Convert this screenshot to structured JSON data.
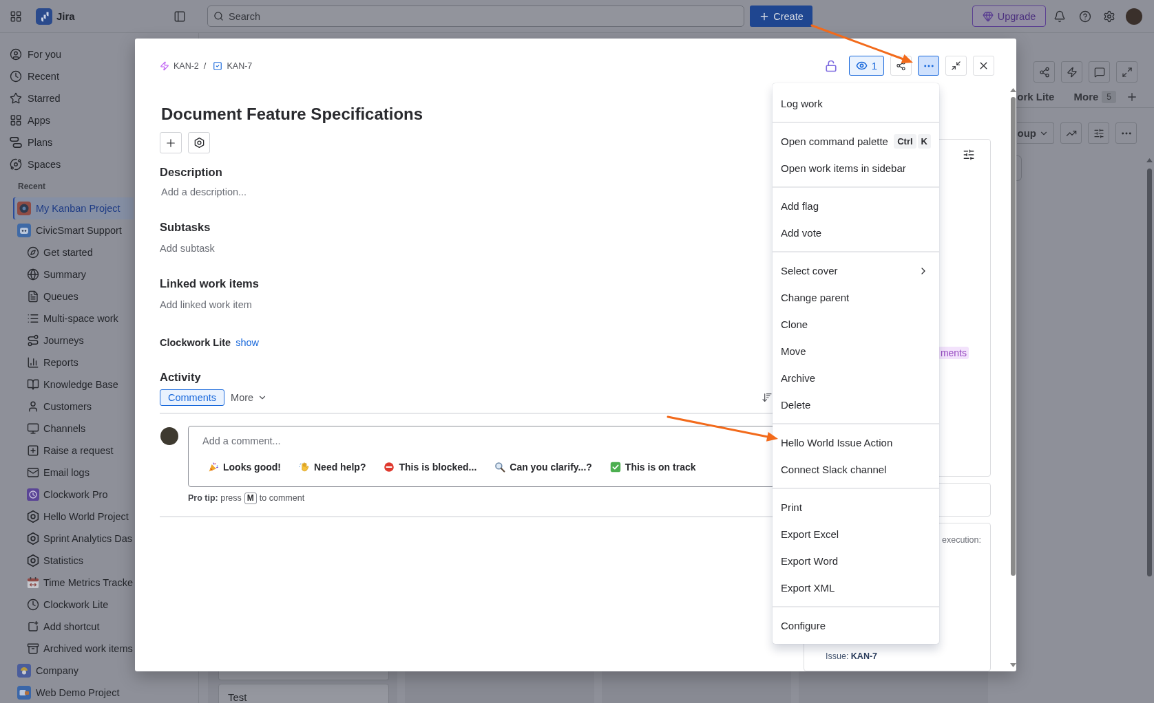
{
  "topbar": {
    "app_name": "Jira",
    "search": {
      "placeholder": "Search"
    },
    "create": "Create",
    "upgrade": "Upgrade"
  },
  "sidebar": {
    "nav": [
      {
        "label": "For you",
        "selected": false
      },
      {
        "label": "Recent",
        "selected": false
      },
      {
        "label": "Starred",
        "selected": false
      },
      {
        "label": "Apps",
        "selected": false
      },
      {
        "label": "Plans",
        "selected": false
      },
      {
        "label": "Spaces",
        "selected": false
      }
    ],
    "recent_heading": "Recent",
    "projects": [
      {
        "name": "My Kanban Project",
        "selected": true
      },
      {
        "name": "CivicSmart Support",
        "selected": false,
        "children": [
          {
            "label": "Get started",
            "selected": false
          },
          {
            "label": "Summary",
            "selected": false
          },
          {
            "label": "Queues",
            "selected": false
          },
          {
            "label": "Multi-space work",
            "selected": false
          },
          {
            "label": "Journeys",
            "selected": false
          },
          {
            "label": "Reports",
            "selected": false
          },
          {
            "label": "Knowledge Base",
            "selected": false
          },
          {
            "label": "Customers",
            "selected": false
          },
          {
            "label": "Channels",
            "selected": false
          },
          {
            "label": "Raise a request",
            "selected": false
          },
          {
            "label": "Email logs",
            "selected": false
          },
          {
            "label": "Clockwork Pro",
            "selected": false
          },
          {
            "label": "Hello World Project",
            "selected": false
          },
          {
            "label": "Sprint Analytics Das",
            "selected": false
          },
          {
            "label": "Statistics",
            "selected": false
          },
          {
            "label": "Time Metrics Tracke",
            "selected": false
          },
          {
            "label": "Clockwork Lite",
            "selected": false
          },
          {
            "label": "Add shortcut",
            "selected": false
          },
          {
            "label": "Archived work items",
            "selected": false
          }
        ]
      },
      {
        "name": "Company",
        "selected": false
      },
      {
        "name": "Web Demo Project",
        "selected": false
      }
    ]
  },
  "board": {
    "tabs": [
      {
        "label": "ork Lite",
        "selected": false
      },
      {
        "label": "More",
        "count": "5",
        "selected": false
      }
    ],
    "group_button": "oup",
    "cards": [
      "Test"
    ]
  },
  "modal": {
    "breadcrumbs": [
      {
        "key": "KAN-2",
        "kind": "epic"
      },
      {
        "key": "KAN-7",
        "kind": "task"
      }
    ],
    "separator": "/",
    "actions": {
      "watching": true,
      "watchers": "1",
      "menu_open": true
    },
    "title": "Document Feature Specifications",
    "sections": [
      {
        "kind": "field",
        "heading": "Description",
        "placeholder": "Add a description..."
      },
      {
        "kind": "action",
        "heading": "Subtasks",
        "action": "Add subtask"
      },
      {
        "kind": "action",
        "heading": "Linked work items",
        "action": "Add linked work item"
      }
    ],
    "app_field": {
      "label": "Clockwork Lite",
      "link": "show"
    },
    "activity": {
      "heading": "Activity",
      "tabs": [
        {
          "label": "Comments",
          "selected": true
        }
      ],
      "more": "More",
      "comment": {
        "placeholder": "Add a comment...",
        "quick_replies": [
          "Looks good!",
          "Need help?",
          "This is blocked...",
          "Can you clarify...?",
          "This is on track"
        ]
      },
      "pro_tip": {
        "lead": "**Pro tip:** press",
        "key": "M",
        "tail": "to comment"
      }
    },
    "details": {
      "tag": "ments",
      "note": "execution:",
      "issue": "Issue: **KAN-7**"
    }
  },
  "menu": {
    "groups": [
      [
        {
          "label": "Log work",
          "kind": "plain"
        }
      ],
      [
        {
          "label": "Open command palette",
          "kind": "shortcut",
          "keys": [
            "Ctrl",
            "K"
          ]
        },
        {
          "label": "Open work items in sidebar",
          "kind": "plain"
        }
      ],
      [
        {
          "label": "Add flag",
          "kind": "plain"
        },
        {
          "label": "Add vote",
          "kind": "plain"
        }
      ],
      [
        {
          "label": "Select cover",
          "kind": "submenu"
        },
        {
          "label": "Change parent",
          "kind": "plain"
        },
        {
          "label": "Clone",
          "kind": "plain"
        },
        {
          "label": "Move",
          "kind": "plain"
        },
        {
          "label": "Archive",
          "kind": "plain"
        },
        {
          "label": "Delete",
          "kind": "plain"
        }
      ],
      [
        {
          "label": "Hello World Issue Action",
          "kind": "plain"
        },
        {
          "label": "Connect Slack channel",
          "kind": "plain"
        }
      ],
      [
        {
          "label": "Print",
          "kind": "plain"
        },
        {
          "label": "Export Excel",
          "kind": "plain"
        },
        {
          "label": "Export Word",
          "kind": "plain"
        },
        {
          "label": "Export XML",
          "kind": "plain"
        }
      ],
      [
        {
          "label": "Configure",
          "kind": "plain"
        }
      ]
    ]
  }
}
